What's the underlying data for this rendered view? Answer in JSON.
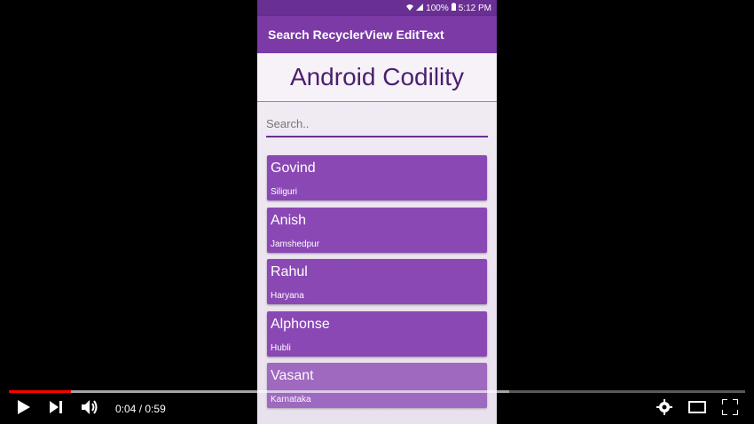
{
  "statusbar": {
    "battery": "100%",
    "time": "5:12 PM"
  },
  "app": {
    "title": "Search RecyclerView EditText",
    "hero_title": "Android Codility"
  },
  "search": {
    "placeholder": "Search.."
  },
  "items": [
    {
      "name": "Govind",
      "city": "Siliguri"
    },
    {
      "name": "Anish",
      "city": "Jamshedpur"
    },
    {
      "name": "Rahul",
      "city": "Haryana"
    },
    {
      "name": "Alphonse",
      "city": "Hubli"
    },
    {
      "name": "Vasant",
      "city": "Karnataka"
    }
  ],
  "player": {
    "current_time": "0:04",
    "separator": "/",
    "duration": "0:59",
    "played_fraction": 0.084,
    "loaded_fraction": 0.68
  },
  "colors": {
    "appbar": "#7b3aa5",
    "card": "#8a48b4",
    "accent": "#6b2f92",
    "progress_red": "#ff0000"
  }
}
